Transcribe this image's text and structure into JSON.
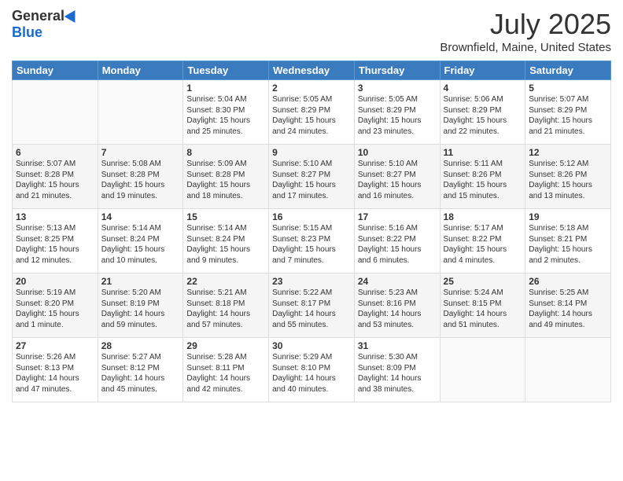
{
  "logo": {
    "general": "General",
    "blue": "Blue"
  },
  "header": {
    "title": "July 2025",
    "subtitle": "Brownfield, Maine, United States"
  },
  "weekdays": [
    "Sunday",
    "Monday",
    "Tuesday",
    "Wednesday",
    "Thursday",
    "Friday",
    "Saturday"
  ],
  "weeks": [
    [
      {
        "day": "",
        "info": ""
      },
      {
        "day": "",
        "info": ""
      },
      {
        "day": "1",
        "info": "Sunrise: 5:04 AM\nSunset: 8:30 PM\nDaylight: 15 hours and 25 minutes."
      },
      {
        "day": "2",
        "info": "Sunrise: 5:05 AM\nSunset: 8:29 PM\nDaylight: 15 hours and 24 minutes."
      },
      {
        "day": "3",
        "info": "Sunrise: 5:05 AM\nSunset: 8:29 PM\nDaylight: 15 hours and 23 minutes."
      },
      {
        "day": "4",
        "info": "Sunrise: 5:06 AM\nSunset: 8:29 PM\nDaylight: 15 hours and 22 minutes."
      },
      {
        "day": "5",
        "info": "Sunrise: 5:07 AM\nSunset: 8:29 PM\nDaylight: 15 hours and 21 minutes."
      }
    ],
    [
      {
        "day": "6",
        "info": "Sunrise: 5:07 AM\nSunset: 8:28 PM\nDaylight: 15 hours and 21 minutes."
      },
      {
        "day": "7",
        "info": "Sunrise: 5:08 AM\nSunset: 8:28 PM\nDaylight: 15 hours and 19 minutes."
      },
      {
        "day": "8",
        "info": "Sunrise: 5:09 AM\nSunset: 8:28 PM\nDaylight: 15 hours and 18 minutes."
      },
      {
        "day": "9",
        "info": "Sunrise: 5:10 AM\nSunset: 8:27 PM\nDaylight: 15 hours and 17 minutes."
      },
      {
        "day": "10",
        "info": "Sunrise: 5:10 AM\nSunset: 8:27 PM\nDaylight: 15 hours and 16 minutes."
      },
      {
        "day": "11",
        "info": "Sunrise: 5:11 AM\nSunset: 8:26 PM\nDaylight: 15 hours and 15 minutes."
      },
      {
        "day": "12",
        "info": "Sunrise: 5:12 AM\nSunset: 8:26 PM\nDaylight: 15 hours and 13 minutes."
      }
    ],
    [
      {
        "day": "13",
        "info": "Sunrise: 5:13 AM\nSunset: 8:25 PM\nDaylight: 15 hours and 12 minutes."
      },
      {
        "day": "14",
        "info": "Sunrise: 5:14 AM\nSunset: 8:24 PM\nDaylight: 15 hours and 10 minutes."
      },
      {
        "day": "15",
        "info": "Sunrise: 5:14 AM\nSunset: 8:24 PM\nDaylight: 15 hours and 9 minutes."
      },
      {
        "day": "16",
        "info": "Sunrise: 5:15 AM\nSunset: 8:23 PM\nDaylight: 15 hours and 7 minutes."
      },
      {
        "day": "17",
        "info": "Sunrise: 5:16 AM\nSunset: 8:22 PM\nDaylight: 15 hours and 6 minutes."
      },
      {
        "day": "18",
        "info": "Sunrise: 5:17 AM\nSunset: 8:22 PM\nDaylight: 15 hours and 4 minutes."
      },
      {
        "day": "19",
        "info": "Sunrise: 5:18 AM\nSunset: 8:21 PM\nDaylight: 15 hours and 2 minutes."
      }
    ],
    [
      {
        "day": "20",
        "info": "Sunrise: 5:19 AM\nSunset: 8:20 PM\nDaylight: 15 hours and 1 minute."
      },
      {
        "day": "21",
        "info": "Sunrise: 5:20 AM\nSunset: 8:19 PM\nDaylight: 14 hours and 59 minutes."
      },
      {
        "day": "22",
        "info": "Sunrise: 5:21 AM\nSunset: 8:18 PM\nDaylight: 14 hours and 57 minutes."
      },
      {
        "day": "23",
        "info": "Sunrise: 5:22 AM\nSunset: 8:17 PM\nDaylight: 14 hours and 55 minutes."
      },
      {
        "day": "24",
        "info": "Sunrise: 5:23 AM\nSunset: 8:16 PM\nDaylight: 14 hours and 53 minutes."
      },
      {
        "day": "25",
        "info": "Sunrise: 5:24 AM\nSunset: 8:15 PM\nDaylight: 14 hours and 51 minutes."
      },
      {
        "day": "26",
        "info": "Sunrise: 5:25 AM\nSunset: 8:14 PM\nDaylight: 14 hours and 49 minutes."
      }
    ],
    [
      {
        "day": "27",
        "info": "Sunrise: 5:26 AM\nSunset: 8:13 PM\nDaylight: 14 hours and 47 minutes."
      },
      {
        "day": "28",
        "info": "Sunrise: 5:27 AM\nSunset: 8:12 PM\nDaylight: 14 hours and 45 minutes."
      },
      {
        "day": "29",
        "info": "Sunrise: 5:28 AM\nSunset: 8:11 PM\nDaylight: 14 hours and 42 minutes."
      },
      {
        "day": "30",
        "info": "Sunrise: 5:29 AM\nSunset: 8:10 PM\nDaylight: 14 hours and 40 minutes."
      },
      {
        "day": "31",
        "info": "Sunrise: 5:30 AM\nSunset: 8:09 PM\nDaylight: 14 hours and 38 minutes."
      },
      {
        "day": "",
        "info": ""
      },
      {
        "day": "",
        "info": ""
      }
    ]
  ]
}
